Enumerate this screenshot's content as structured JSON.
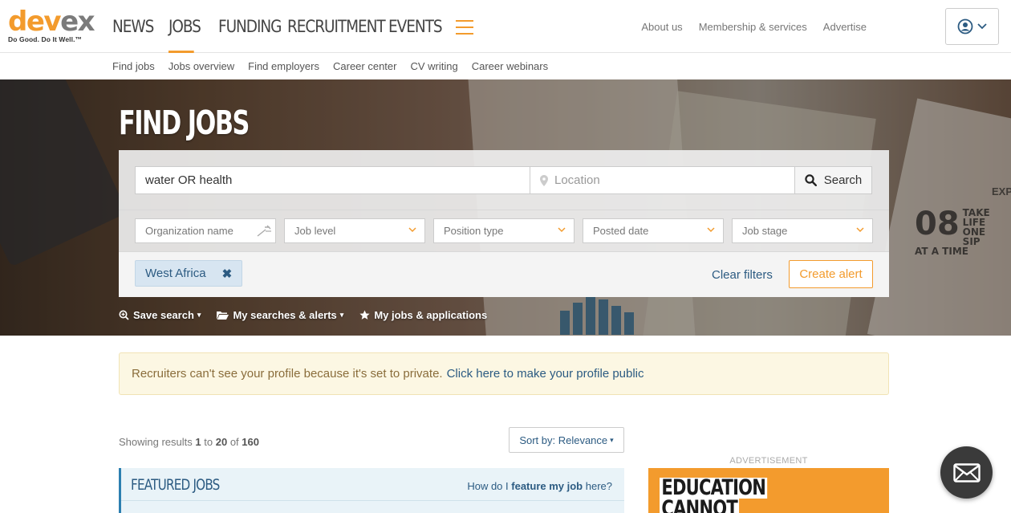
{
  "logo": {
    "part1": "dev",
    "part2": "ex",
    "tagline": "Do Good. Do It Well.™"
  },
  "main_nav": {
    "items": [
      "NEWS",
      "JOBS",
      "FUNDING",
      "RECRUITMENT",
      "EVENTS"
    ],
    "active": "JOBS"
  },
  "header_links": [
    "About us",
    "Membership & services",
    "Advertise"
  ],
  "sub_nav": [
    "Find jobs",
    "Jobs overview",
    "Find employers",
    "Career center",
    "CV writing",
    "Career webinars"
  ],
  "hero": {
    "title": "FIND JOBS",
    "keyword_value": "water OR health",
    "location_placeholder": "Location",
    "search_label": "Search",
    "filters": {
      "organization": "Organization name",
      "job_level": "Job level",
      "position_type": "Position type",
      "posted_date": "Posted date",
      "job_stage": "Job stage"
    },
    "active_filter": "West Africa",
    "clear_filters": "Clear filters",
    "create_alert": "Create alert",
    "actions": {
      "save_search": "Save search",
      "my_searches": "My searches & alerts",
      "my_jobs": "My jobs & applications"
    },
    "photo_text": {
      "big": "08",
      "line": "TAKE LIFE ONE SIP AT A TIME",
      "exp": "EXP"
    }
  },
  "alert": {
    "text": "Recruiters can't see your profile because it's set to private.",
    "link": "Click here to make your profile public"
  },
  "results": {
    "prefix": "Showing results",
    "from": "1",
    "to_word": "to",
    "to": "20",
    "of_word": "of",
    "total": "160"
  },
  "sort": {
    "label": "Sort by: Relevance"
  },
  "featured": {
    "title": "FEATURED JOBS",
    "help_prefix": "How do I",
    "help_bold": "feature my job",
    "help_suffix": "here?"
  },
  "ad": {
    "label": "ADVERTISEMENT",
    "line1": "EDUCATION",
    "line2": "CANNOT"
  },
  "colors": {
    "brand_orange": "#f39b2d",
    "link_blue": "#2c5b82",
    "alert_bg": "#fcf7e3"
  },
  "icons": [
    "user-circle-icon",
    "map-pin-icon",
    "search-icon",
    "wrench-icon",
    "chevron-down-icon",
    "close-icon",
    "star-icon",
    "folder-icon",
    "mail-icon"
  ]
}
